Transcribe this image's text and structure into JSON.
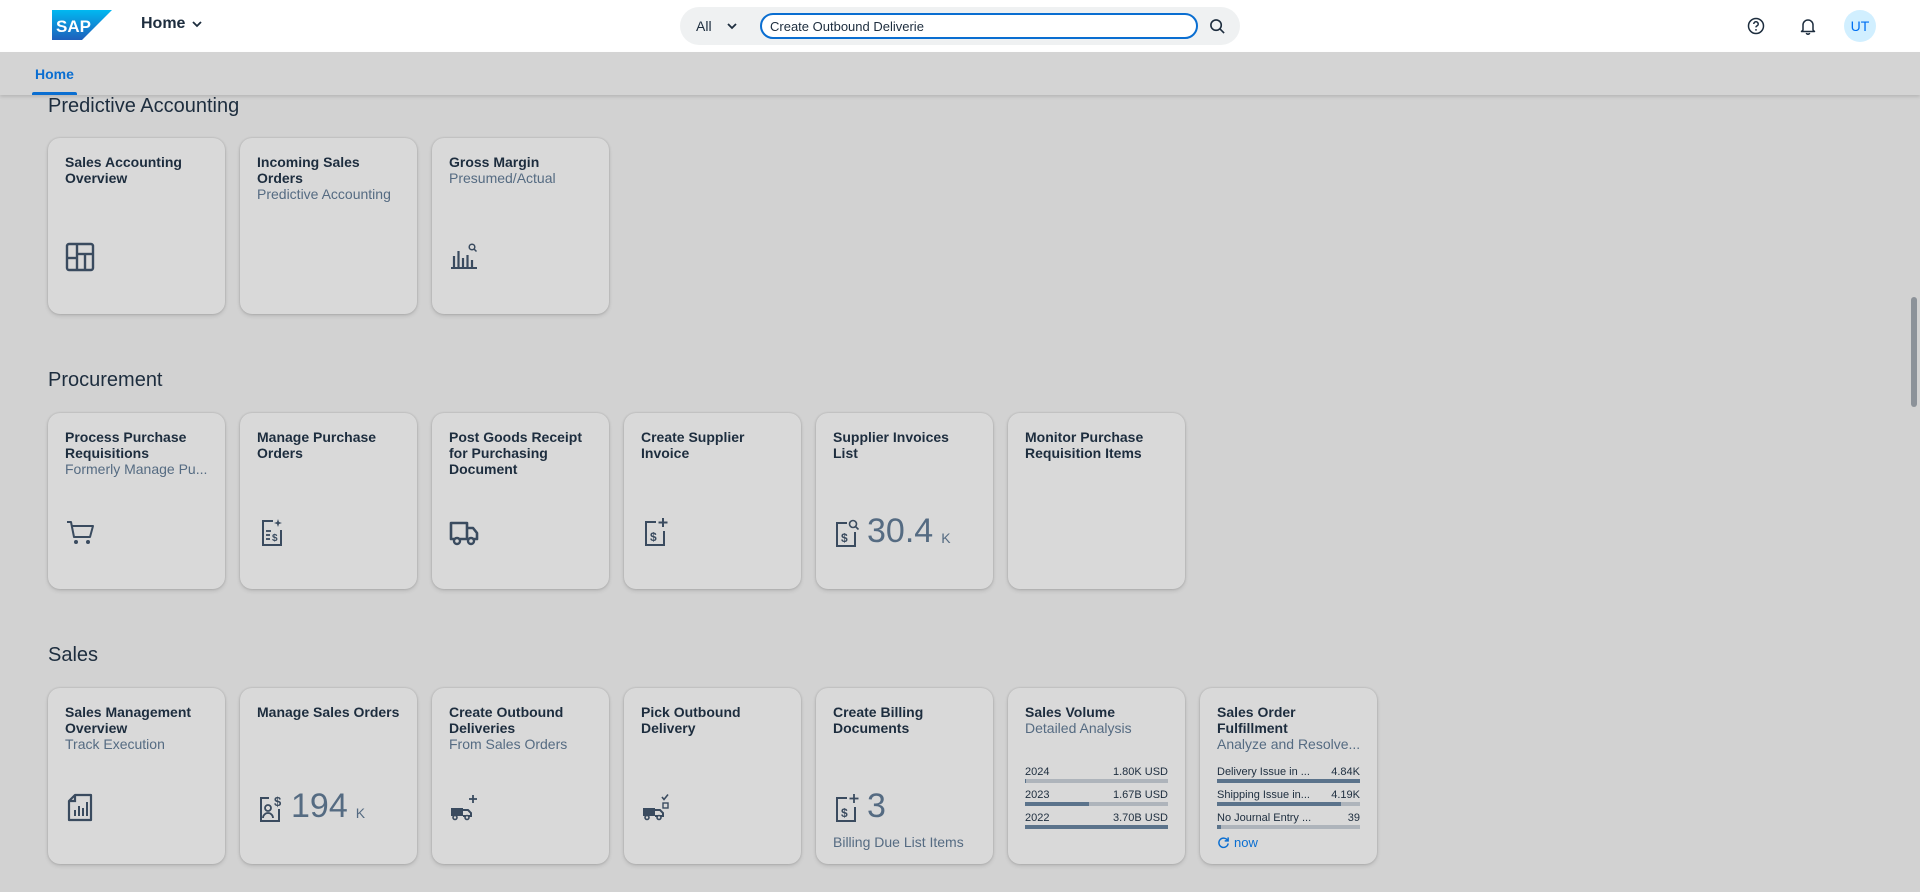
{
  "shell": {
    "logo_text": "SAP",
    "home_label": "Home",
    "search_scope": "All",
    "search_value": "Create Outbound Deliverie",
    "avatar_initials": "UT"
  },
  "tabs": [
    {
      "label": "Home",
      "selected": true
    }
  ],
  "colors": {
    "accent": "#0a6ed1",
    "shell": "#ffffff",
    "background": "#d2d2d2",
    "tile": "#d9d9d9"
  },
  "sections": {
    "predictive": {
      "title": "Predictive Accounting",
      "tiles": [
        {
          "title": "Sales Accounting Overview",
          "subtitle": "",
          "icon": "overview-grid-icon"
        },
        {
          "title": "Incoming Sales Orders",
          "subtitle": "Predictive Accounting",
          "icon": ""
        },
        {
          "title": "Gross Margin",
          "subtitle": "Presumed/Actual",
          "icon": "bar-chart-search-icon"
        }
      ]
    },
    "procurement": {
      "title": "Procurement",
      "tiles": [
        {
          "title": "Process Purchase Requisitions",
          "subtitle": "Formerly Manage Pu...",
          "icon": "cart-icon"
        },
        {
          "title": "Manage Purchase Orders",
          "subtitle": "",
          "icon": "purchase-order-icon"
        },
        {
          "title": "Post Goods Receipt for Purchasing Document",
          "subtitle": "",
          "icon": "truck-icon"
        },
        {
          "title": "Create Supplier Invoice",
          "subtitle": "",
          "icon": "invoice-add-icon"
        },
        {
          "title": "Supplier Invoices List",
          "subtitle": "",
          "icon": "invoice-search-icon",
          "kpi_value": "30.4",
          "kpi_unit": "K"
        },
        {
          "title": "Monitor Purchase Requisition Items",
          "subtitle": "",
          "icon": ""
        }
      ]
    },
    "sales": {
      "title": "Sales",
      "tiles": [
        {
          "title": "Sales Management Overview",
          "subtitle": "Track Execution",
          "icon": "report-chart-icon"
        },
        {
          "title": "Manage Sales Orders",
          "subtitle": "",
          "icon": "sales-order-icon",
          "kpi_value": "194",
          "kpi_unit": "K"
        },
        {
          "title": "Create Outbound Deliveries",
          "subtitle": "From Sales Orders",
          "icon": "delivery-add-icon"
        },
        {
          "title": "Pick Outbound Delivery",
          "subtitle": "",
          "icon": "delivery-pick-icon"
        },
        {
          "title": "Create Billing Documents",
          "subtitle": "",
          "icon": "billing-add-icon",
          "kpi_value": "3",
          "footer": "Billing Due List Items"
        },
        {
          "title": "Sales Volume",
          "subtitle": "Detailed Analysis",
          "bars": [
            {
              "label": "2024",
              "value": "1.80K USD",
              "fraction": 0.0005
            },
            {
              "label": "2023",
              "value": "1.67B USD",
              "fraction": 0.45
            },
            {
              "label": "2022",
              "value": "3.70B USD",
              "fraction": 1.0
            }
          ]
        },
        {
          "title": "Sales Order Fulfillment",
          "subtitle": "Analyze and Resolve...",
          "bars": [
            {
              "label": "Delivery Issue in ...",
              "value": "4.84K",
              "fraction": 1.0
            },
            {
              "label": "Shipping Issue in...",
              "value": "4.19K",
              "fraction": 0.87
            },
            {
              "label": "No Journal Entry ...",
              "value": "39",
              "fraction": 0.03
            }
          ],
          "refresh_label": "now"
        }
      ]
    }
  }
}
